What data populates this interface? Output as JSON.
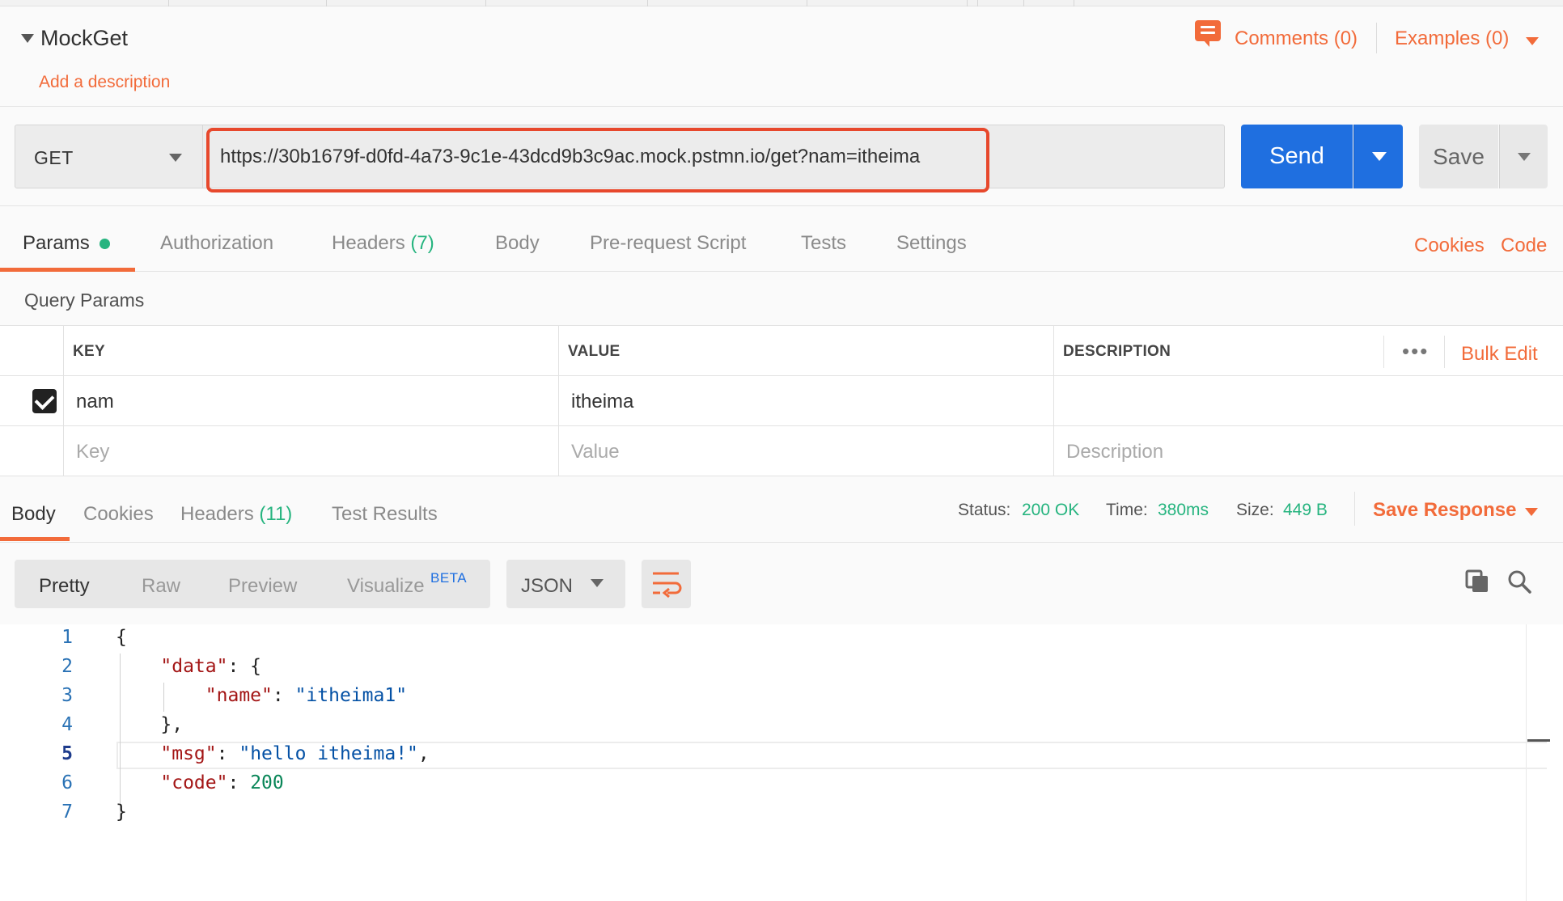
{
  "request": {
    "name": "MockGet",
    "add_description": "Add a description",
    "comments_label": "Comments (0)",
    "examples_label": "Examples (0)",
    "method": "GET",
    "url": "https://30b1679f-d0fd-4a73-9c1e-43dcd9b3c9ac.mock.pstmn.io/get?nam=itheima",
    "send_label": "Send",
    "save_label": "Save"
  },
  "request_tabs": {
    "params": "Params",
    "authorization": "Authorization",
    "headers": "Headers",
    "headers_count": "(7)",
    "body": "Body",
    "pre_request": "Pre-request Script",
    "tests": "Tests",
    "settings": "Settings",
    "cookies": "Cookies",
    "code": "Code"
  },
  "query_params": {
    "title": "Query Params",
    "columns": [
      "KEY",
      "VALUE",
      "DESCRIPTION"
    ],
    "more_icon": "•••",
    "bulk_edit": "Bulk Edit",
    "rows": [
      {
        "checked": true,
        "key": "nam",
        "value": "itheima",
        "description": ""
      }
    ],
    "placeholders": {
      "key": "Key",
      "value": "Value",
      "description": "Description"
    }
  },
  "response": {
    "tabs": {
      "body": "Body",
      "cookies": "Cookies",
      "headers": "Headers",
      "headers_count": "(11)",
      "test_results": "Test Results"
    },
    "status_label": "Status:",
    "status_value": "200 OK",
    "time_label": "Time:",
    "time_value": "380ms",
    "size_label": "Size:",
    "size_value": "449 B",
    "save_response": "Save Response",
    "view_modes": [
      "Pretty",
      "Raw",
      "Preview",
      "Visualize"
    ],
    "beta_badge": "BETA",
    "format": "JSON",
    "line_numbers": [
      "1",
      "2",
      "3",
      "4",
      "5",
      "6",
      "7"
    ]
  },
  "colors": {
    "accent": "#f26b3a",
    "send_blue": "#1f6fe0",
    "status_green": "#26b47f",
    "url_highlight": "#e7482c"
  },
  "icons": {
    "collapse": "caret-down-icon",
    "comments": "comment-bubble-icon",
    "copy": "copy-icon",
    "search": "search-icon",
    "wrap": "text-wrap-icon"
  }
}
